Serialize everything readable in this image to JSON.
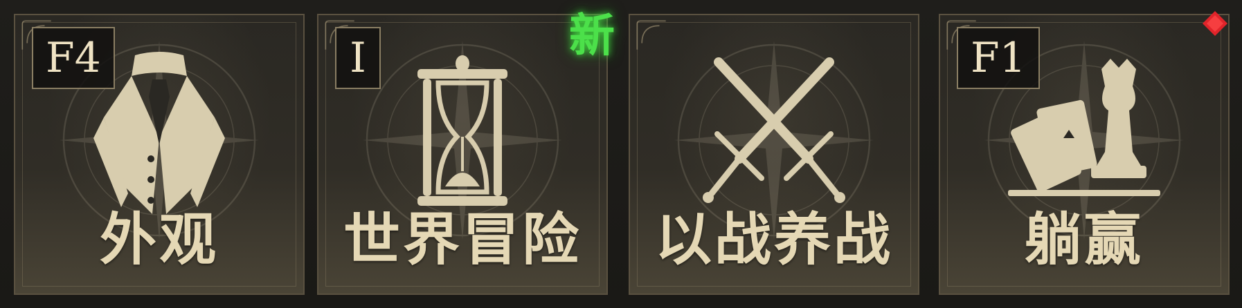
{
  "cards": [
    {
      "hotkey": "F4",
      "label": "外观",
      "icon": "suit-icon"
    },
    {
      "hotkey": "I",
      "label": "世界冒险",
      "icon": "hourglass-icon"
    },
    {
      "hotkey": "",
      "label": "以战养战",
      "icon": "crossed-swords-icon"
    },
    {
      "hotkey": "F1",
      "label": "躺赢",
      "icon": "cards-and-chess-icon"
    }
  ],
  "new_badge": "新",
  "colors": {
    "badge_green": "#4ce04a",
    "notification_red": "#e0242a",
    "label_cream": "#e5d8b5",
    "icon_cream": "#d8cdae"
  }
}
